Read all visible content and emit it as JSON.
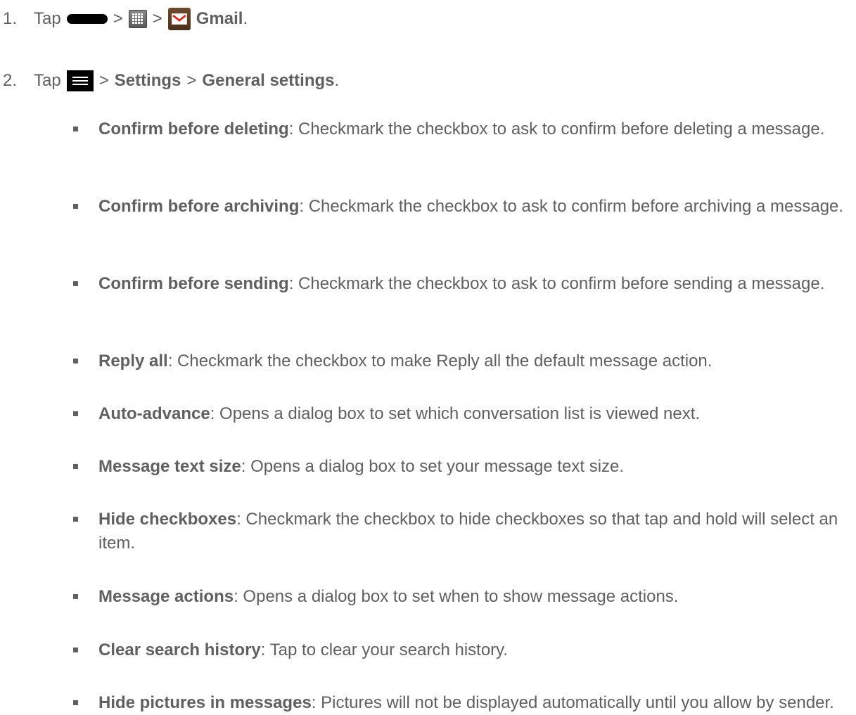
{
  "steps": [
    {
      "number": "1.",
      "tap": "Tap",
      "sep1": ">",
      "sep2": ">",
      "app_name": "Gmail",
      "end": "."
    },
    {
      "number": "2.",
      "tap": "Tap",
      "sep1": ">",
      "settings": "Settings",
      "sep2": ">",
      "general_settings": "General settings",
      "end": "."
    }
  ],
  "icons": {
    "home": "home-key-icon",
    "apps": "apps-grid-icon",
    "gmail": "gmail-envelope-icon",
    "menu": "menu-icon"
  },
  "options": [
    {
      "name": "Confirm before deleting",
      "desc": ": Checkmark the checkbox to ask to confirm before deleting a message."
    },
    {
      "name": "Confirm before archiving",
      "desc": ": Checkmark the checkbox to ask to confirm before archiving a message."
    },
    {
      "name": "Confirm before sending",
      "desc": ": Checkmark the checkbox to ask to confirm before sending a message."
    },
    {
      "name": "Reply all",
      "desc": ": Checkmark the checkbox to make Reply all the default message action."
    },
    {
      "name": "Auto-advance",
      "desc": ": Opens a dialog box to set which conversation list is viewed next."
    },
    {
      "name": "Message text size",
      "desc": ": Opens a dialog box to set your message text size."
    },
    {
      "name": "Hide checkboxes",
      "desc": ": Checkmark the checkbox to hide checkboxes so that tap and hold will select an item."
    },
    {
      "name": "Message actions",
      "desc": ": Opens a dialog box to set when to show message actions."
    },
    {
      "name": "Clear search history",
      "desc": ": Tap to clear your search history."
    },
    {
      "name": "Hide pictures in messages",
      "desc": ": Pictures will not be displayed automatically until you allow by sender."
    }
  ]
}
